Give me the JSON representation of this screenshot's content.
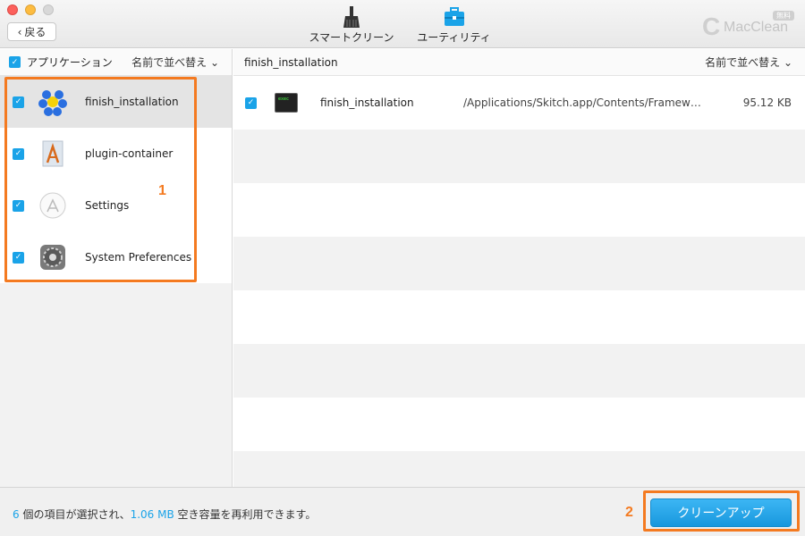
{
  "window": {
    "back_label": "戻る",
    "tools": [
      {
        "label": "スマートクリーン",
        "icon": "broom-icon"
      },
      {
        "label": "ユーティリティ",
        "icon": "toolbox-icon"
      }
    ],
    "brand": {
      "letter": "C",
      "name": "MacClean",
      "badge": "無料"
    }
  },
  "left_panel": {
    "header_title": "アプリケーション",
    "sort_label": "名前で並べ替え",
    "apps": [
      {
        "name": "finish_installation",
        "icon": "molecule-icon",
        "selected": true
      },
      {
        "name": "plugin-container",
        "icon": "installer-icon",
        "selected": false
      },
      {
        "name": "Settings",
        "icon": "app-store-icon",
        "selected": false
      },
      {
        "name": "System Preferences",
        "icon": "gear-icon",
        "selected": false
      }
    ]
  },
  "right_panel": {
    "header_title": "finish_installation",
    "sort_label": "名前で並べ替え",
    "files": [
      {
        "name": "finish_installation",
        "path": "/Applications/Skitch.app/Contents/Frameworks/...",
        "size": "95.12 KB",
        "icon": "terminal-icon",
        "icon_text": "exec"
      }
    ]
  },
  "status": {
    "count": "6",
    "text_1": " 個の項目が選択され、",
    "amount": "1.06 MB",
    "text_2": " 空き容量を再利用できます。",
    "clean_button": "クリーンアップ"
  },
  "annotations": {
    "one": "1",
    "two": "2"
  },
  "colors": {
    "accent": "#1aa3e8",
    "annotation": "#f47a20"
  }
}
